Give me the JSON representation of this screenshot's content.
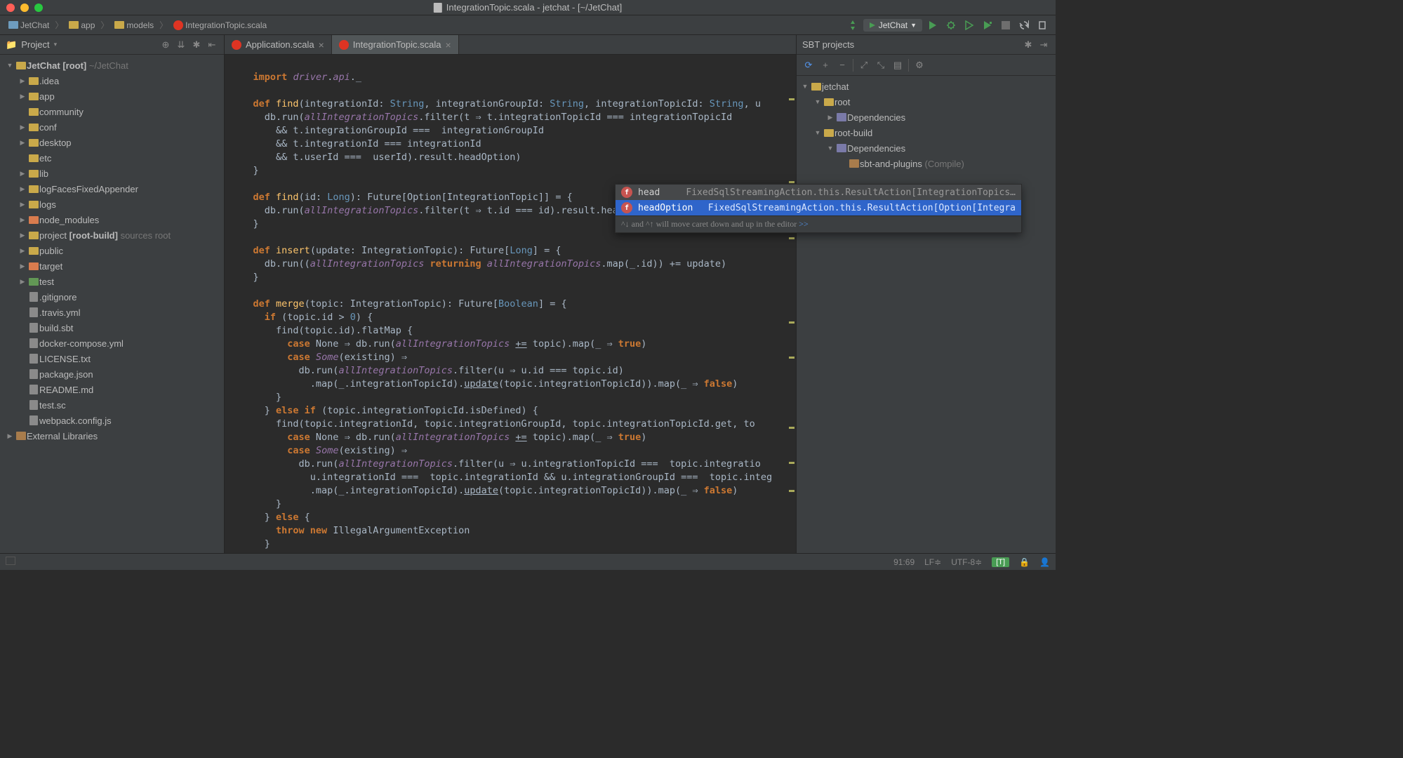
{
  "window": {
    "title": "IntegrationTopic.scala - jetchat - [~/JetChat]"
  },
  "breadcrumb": [
    {
      "icon": "folder-blue",
      "label": "JetChat"
    },
    {
      "icon": "folder",
      "label": "app"
    },
    {
      "icon": "folder",
      "label": "models"
    },
    {
      "icon": "scala",
      "label": "IntegrationTopic.scala"
    }
  ],
  "run_config": "JetChat",
  "left_panel": {
    "title": "Project",
    "root": {
      "label": "JetChat",
      "tag": "[root]",
      "path": "~/JetChat"
    },
    "nodes": [
      {
        "indent": 1,
        "arrow": "▶",
        "icon": "folder-y",
        "label": ".idea"
      },
      {
        "indent": 1,
        "arrow": "▶",
        "icon": "folder-y",
        "label": "app"
      },
      {
        "indent": 1,
        "arrow": "",
        "icon": "folder-y",
        "label": "community"
      },
      {
        "indent": 1,
        "arrow": "▶",
        "icon": "folder-y",
        "label": "conf"
      },
      {
        "indent": 1,
        "arrow": "▶",
        "icon": "folder-y",
        "label": "desktop"
      },
      {
        "indent": 1,
        "arrow": "",
        "icon": "folder-y",
        "label": "etc"
      },
      {
        "indent": 1,
        "arrow": "▶",
        "icon": "folder-y",
        "label": "lib"
      },
      {
        "indent": 1,
        "arrow": "▶",
        "icon": "folder-y",
        "label": "logFacesFixedAppender"
      },
      {
        "indent": 1,
        "arrow": "▶",
        "icon": "folder-y",
        "label": "logs"
      },
      {
        "indent": 1,
        "arrow": "▶",
        "icon": "folder-o",
        "label": "node_modules"
      },
      {
        "indent": 1,
        "arrow": "▶",
        "icon": "folder-y",
        "label": "project",
        "suffix": "[root-build]",
        "hint": "sources root"
      },
      {
        "indent": 1,
        "arrow": "▶",
        "icon": "folder-y",
        "label": "public"
      },
      {
        "indent": 1,
        "arrow": "▶",
        "icon": "folder-o",
        "label": "target"
      },
      {
        "indent": 1,
        "arrow": "▶",
        "icon": "folder-g",
        "label": "test"
      },
      {
        "indent": 1,
        "arrow": "",
        "icon": "file",
        "label": ".gitignore"
      },
      {
        "indent": 1,
        "arrow": "",
        "icon": "file",
        "label": ".travis.yml"
      },
      {
        "indent": 1,
        "arrow": "",
        "icon": "file",
        "label": "build.sbt"
      },
      {
        "indent": 1,
        "arrow": "",
        "icon": "file",
        "label": "docker-compose.yml"
      },
      {
        "indent": 1,
        "arrow": "",
        "icon": "file",
        "label": "LICENSE.txt"
      },
      {
        "indent": 1,
        "arrow": "",
        "icon": "file",
        "label": "package.json"
      },
      {
        "indent": 1,
        "arrow": "",
        "icon": "file",
        "label": "README.md"
      },
      {
        "indent": 1,
        "arrow": "",
        "icon": "file",
        "label": "test.sc"
      },
      {
        "indent": 1,
        "arrow": "",
        "icon": "file",
        "label": "webpack.config.js"
      }
    ],
    "external": "External Libraries"
  },
  "tabs": [
    {
      "label": "Application.scala",
      "active": false
    },
    {
      "label": "IntegrationTopic.scala",
      "active": true
    }
  ],
  "completion": {
    "items": [
      {
        "name": "head",
        "type": "FixedSqlStreamingAction.this.ResultAction[IntegrationTopics…",
        "selected": false
      },
      {
        "name": "headOption",
        "type": "FixedSqlStreamingAction.this.ResultAction[Option[Integra",
        "selected": true
      }
    ],
    "hint_pre": "^↓ and ^↑ will move caret down and up in the editor  ",
    "hint_link": ">>"
  },
  "right_panel": {
    "title": "SBT projects",
    "root": "jetchat",
    "nodes": [
      {
        "indent": 1,
        "arrow": "▼",
        "icon": "folder-y",
        "label": "root"
      },
      {
        "indent": 2,
        "arrow": "▶",
        "icon": "dep",
        "label": "Dependencies"
      },
      {
        "indent": 1,
        "arrow": "▼",
        "icon": "folder-y",
        "label": "root-build"
      },
      {
        "indent": 2,
        "arrow": "▼",
        "icon": "dep",
        "label": "Dependencies"
      },
      {
        "indent": 3,
        "arrow": "",
        "icon": "plugin",
        "label": "sbt-and-plugins",
        "hint": "(Compile)"
      }
    ]
  },
  "status": {
    "pos": "91:69",
    "line_sep": "LF≑",
    "encoding": "UTF-8≑",
    "git": "[T]"
  }
}
